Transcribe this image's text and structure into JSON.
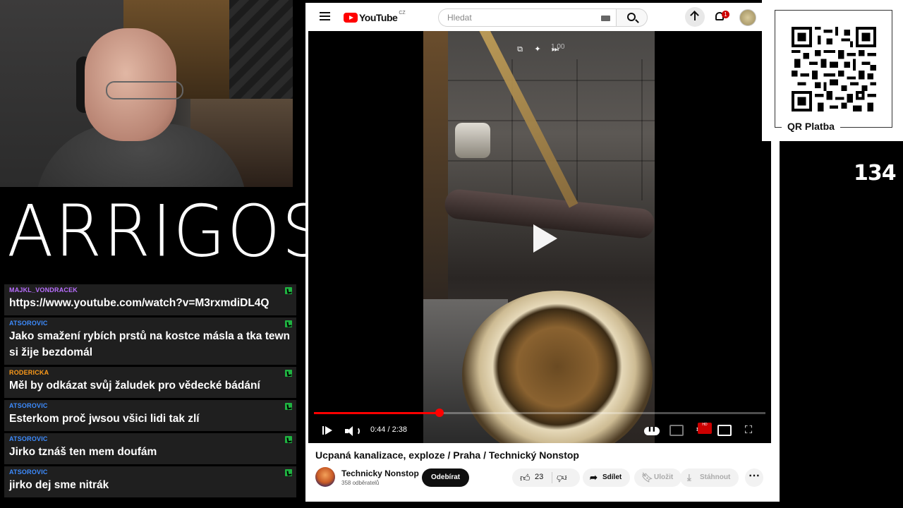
{
  "stream": {
    "logo_text": "ARRIGOS",
    "viewer_count": "134",
    "qr_label": "QR Platba"
  },
  "chat": {
    "messages": [
      {
        "user": "MAJKL_VONDRACEK",
        "color": "#b96eff",
        "text": "https://www.youtube.com/watch?v=M3rxmdiDL4Q"
      },
      {
        "user": "ATSOROVIC",
        "color": "#3d8cff",
        "text": "Jako smažení rybích prstů na kostce másla a tka tewn si žije bezdomál"
      },
      {
        "user": "RODERICKA",
        "color": "#ff9c1a",
        "text": "Měl by odkázat svůj žaludek pro vědecké bádání"
      },
      {
        "user": "ATSOROVIC",
        "color": "#3d8cff",
        "text": "Esterkom proč jwsou všici lidi tak zlí"
      },
      {
        "user": "ATSOROVIC",
        "color": "#3d8cff",
        "text": "Jirko tznáš ten mem doufám"
      },
      {
        "user": "ATSOROVIC",
        "color": "#3d8cff",
        "text": "jirko dej sme nitrák"
      }
    ]
  },
  "youtube": {
    "wordmark": "YouTube",
    "country": "CZ",
    "search_placeholder": "Hledat",
    "notification_count": "1",
    "player": {
      "speed_label": "1.00",
      "current_time": "0:44",
      "duration": "2:38",
      "time_display": "0:44 / 2:38",
      "progress_fraction": 0.2785
    },
    "video": {
      "title": "Ucpaná kanalizace, exploze / Praha / Technický Nonstop",
      "channel_name": "Technicky Nonstop",
      "subscribers": "358 odběratelů",
      "subscribe_label": "Odebírat",
      "like_count": "23",
      "share_label": "Sdílet",
      "save_label": "Uložit",
      "download_label": "Stáhnout"
    }
  }
}
